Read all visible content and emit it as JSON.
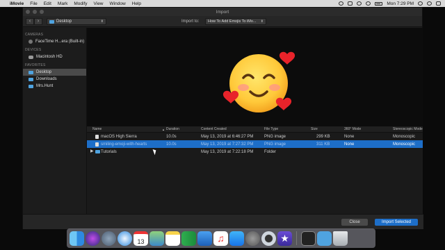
{
  "menubar": {
    "app_name": "iMovie",
    "items": [
      "File",
      "Edit",
      "Mark",
      "Modify",
      "View",
      "Window",
      "Help"
    ],
    "clock": "Mon 7:29 PM"
  },
  "window": {
    "title": "Import",
    "location": "Desktop",
    "import_to_label": "Import to:",
    "import_to_value": "How To Add Emojis To iMo..."
  },
  "sidebar": {
    "cameras_label": "CAMERAS",
    "cameras": [
      "FaceTime H...era (Built-in)"
    ],
    "devices_label": "DEVICES",
    "devices": [
      "Macintosh HD"
    ],
    "favorites_label": "FAVORITES",
    "favorites": [
      "Desktop",
      "Downloads",
      "Mrs.Hunt"
    ],
    "selected": "Desktop"
  },
  "table": {
    "headers": {
      "name": "Name",
      "duration": "Duration",
      "created": "Content Created",
      "type": "File Type",
      "size": "Size",
      "mode360": "360° Mode",
      "stereo": "Stereoscopic Mode"
    },
    "rows": [
      {
        "name": "macOS High Sierra",
        "duration": "10.0s",
        "created": "May 13, 2019 at 6:46:27 PM",
        "type": "PNG image",
        "size": "299 KB",
        "mode360": "None",
        "stereo": "Monoscopic"
      },
      {
        "name": "smiling-emoji-with-hearts",
        "duration": "10.0s",
        "created": "May 13, 2019 at 7:27:32 PM",
        "type": "PNG image",
        "size": "311 KB",
        "mode360": "None",
        "stereo": "Monoscopic"
      },
      {
        "name": "Tutorials",
        "duration": "",
        "created": "May 13, 2019 at 7:22:18 PM",
        "type": "Folder",
        "size": "",
        "mode360": "",
        "stereo": ""
      }
    ]
  },
  "footer": {
    "close_label": "Close",
    "import_label": "Import Selected"
  },
  "dock": {
    "calendar_day": "13",
    "apps": [
      "finder-icon",
      "siri-icon",
      "launchpad-icon",
      "safari-icon",
      "calendar-icon",
      "preview-icon",
      "notes-icon",
      "numbers-icon",
      "keynote-icon",
      "music-icon",
      "app-store-icon",
      "system-preferences-icon",
      "quicktime-icon",
      "imovie-icon",
      "terminal-icon",
      "folder-icon",
      "trash-icon"
    ]
  },
  "colors": {
    "selection": "#1d6ec8",
    "folder_blue": "#4fa3e0"
  }
}
